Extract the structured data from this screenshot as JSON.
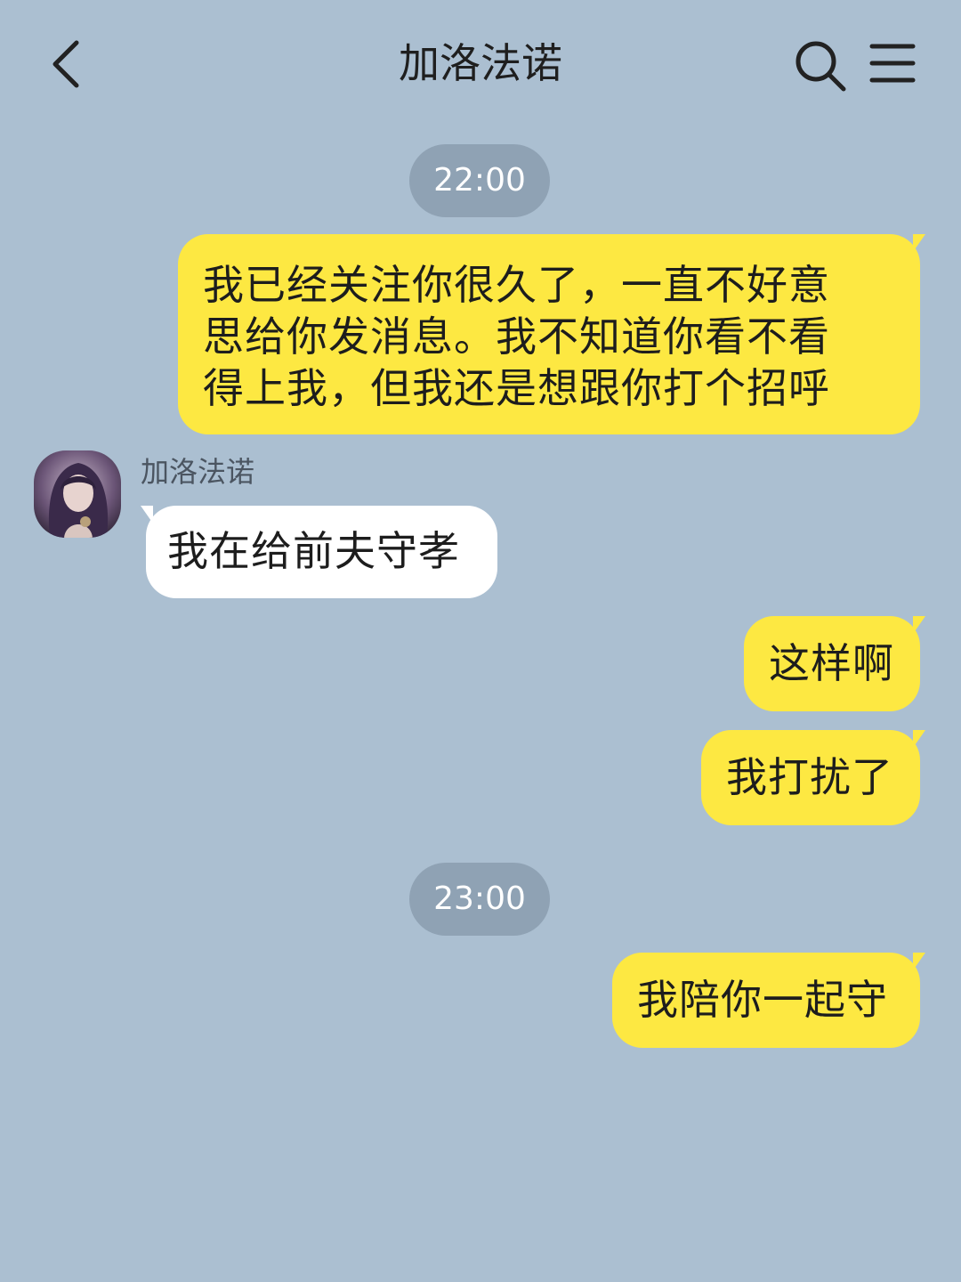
{
  "header": {
    "title": "加洛法诺",
    "back_icon": "chevron-left-icon",
    "search_icon": "search-icon",
    "menu_icon": "hamburger-menu-icon"
  },
  "colors": {
    "background": "#abbfd1",
    "outgoing_bubble": "#fde842",
    "incoming_bubble": "#ffffff",
    "time_pill": "#8fa2b4"
  },
  "timestamps": {
    "first": "22:00",
    "second": "23:00"
  },
  "contact": {
    "name": "加洛法诺"
  },
  "messages": [
    {
      "direction": "outgoing",
      "lines": [
        "我已经关注你很久了，一直不好意",
        "思给你发消息。我不知道你看不看",
        "得上我，但我还是想跟你打个招呼"
      ]
    },
    {
      "direction": "incoming",
      "text": "我在给前夫守孝"
    },
    {
      "direction": "outgoing",
      "text": "这样啊"
    },
    {
      "direction": "outgoing",
      "text": "我打扰了"
    },
    {
      "direction": "outgoing",
      "text": "我陪你一起守"
    }
  ]
}
